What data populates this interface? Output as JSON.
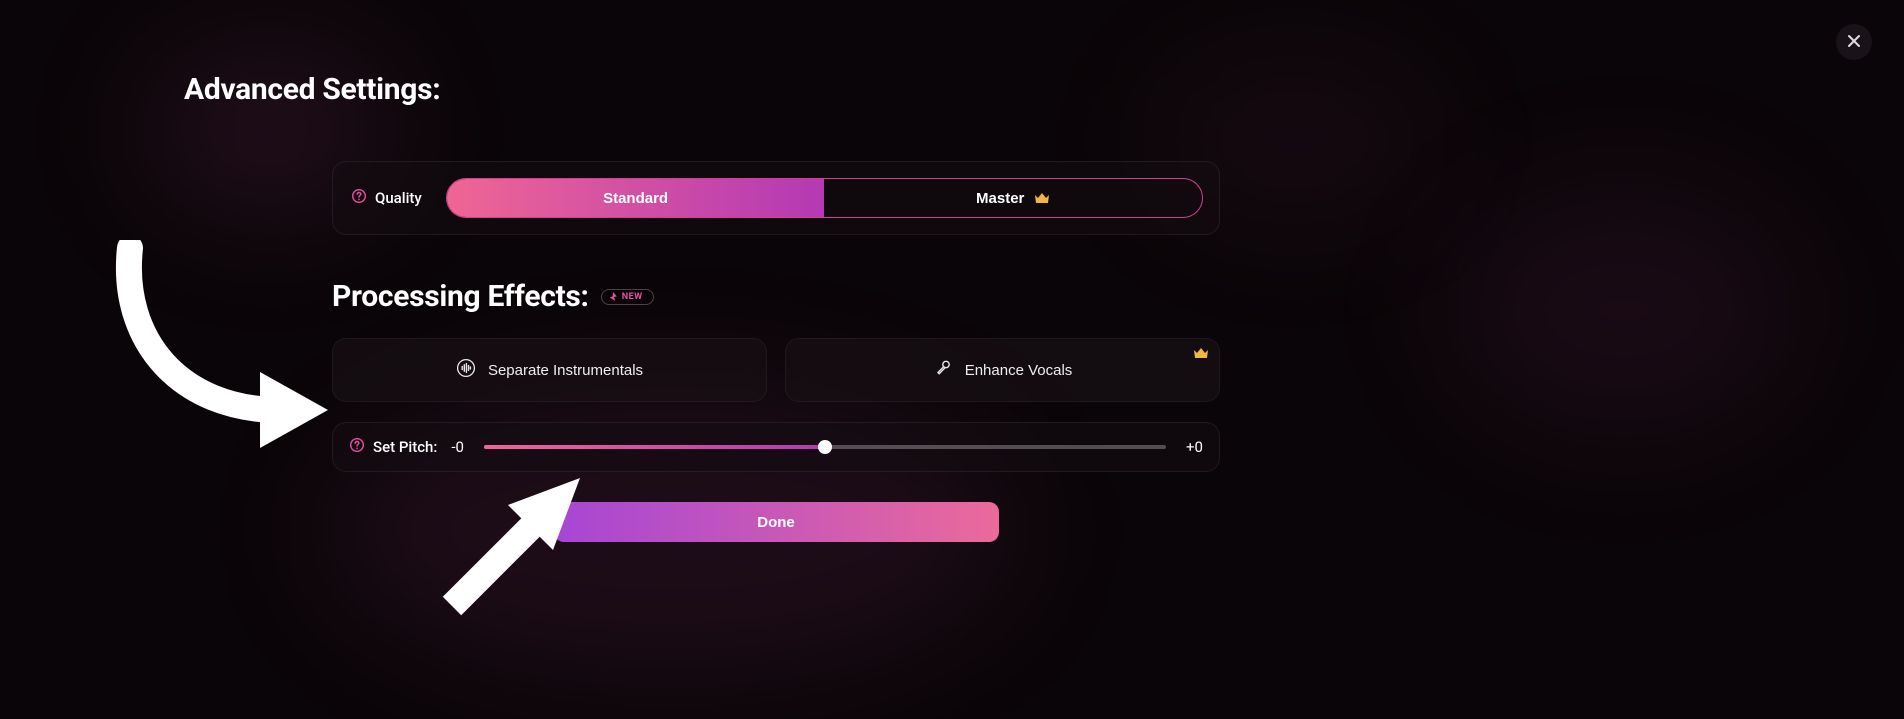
{
  "title": "Advanced Settings:",
  "quality": {
    "label": "Quality",
    "options": {
      "standard": "Standard",
      "master": "Master"
    },
    "selected": "standard"
  },
  "processing": {
    "heading": "Processing Effects:",
    "badge": "NEW",
    "effects": {
      "separate": "Separate Instrumentals",
      "enhance": "Enhance Vocals"
    }
  },
  "pitch": {
    "label": "Set Pitch:",
    "min_label": "-0",
    "max_label": "+0",
    "slider_percent": 50
  },
  "actions": {
    "done": "Done"
  },
  "colors": {
    "accent_pink": "#e94fa0",
    "gradient_start": "#ef6694",
    "gradient_end": "#b439b4",
    "crown": "#f4b63e"
  }
}
